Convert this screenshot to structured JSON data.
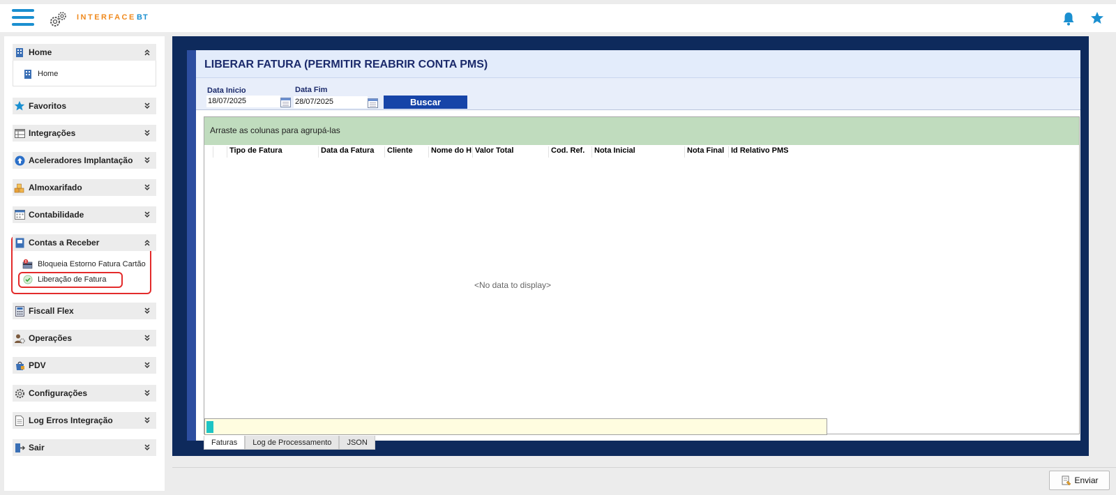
{
  "app": {
    "brand": "INTERFACE",
    "brand_suffix": "BT"
  },
  "sidebar": {
    "items": [
      {
        "label": "Home",
        "expanded": true,
        "sub": [
          {
            "label": "Home"
          }
        ]
      },
      {
        "label": "Favoritos"
      },
      {
        "label": "Integrações"
      },
      {
        "label": "Aceleradores Implantação"
      },
      {
        "label": "Almoxarifado"
      },
      {
        "label": "Contabilidade"
      },
      {
        "label": "Contas a Receber",
        "expanded": true,
        "sub": [
          {
            "label": "Bloqueia Estorno Fatura Cartão"
          },
          {
            "label": "Liberação de Fatura"
          }
        ]
      },
      {
        "label": "Fiscall Flex"
      },
      {
        "label": "Operações"
      },
      {
        "label": "PDV"
      },
      {
        "label": "Configurações"
      },
      {
        "label": "Log Erros Integração"
      },
      {
        "label": "Sair"
      }
    ]
  },
  "page": {
    "title": "LIBERAR FATURA (PERMITIR REABRIR CONTA PMS)",
    "filters": {
      "data_inicio_label": "Data Inicio",
      "data_inicio_value": "18/07/2025",
      "data_fim_label": "Data Fim",
      "data_fim_value": "28/07/2025",
      "buscar_label": "Buscar"
    },
    "grid": {
      "group_hint": "Arraste as colunas para agrupá-las",
      "columns": [
        "Tipo de Fatura",
        "Data da Fatura",
        "Cliente",
        "Nome do H",
        "Valor Total",
        "Cod. Ref.",
        "Nota Inicial",
        "Nota Final",
        "Id Relativo PMS"
      ],
      "empty_text": "<No data to display>"
    },
    "tabs": [
      "Faturas",
      "Log de Processamento",
      "JSON"
    ],
    "active_tab": "Faturas"
  },
  "footer": {
    "enviar_label": "Enviar"
  },
  "colors": {
    "accent_blue": "#1a8fd0",
    "brand_orange": "#f08a1e",
    "frame_navy": "#0e2a5c",
    "button_blue": "#1644a8",
    "group_green": "#c0dcbe",
    "highlight_red": "#e32b2b"
  }
}
